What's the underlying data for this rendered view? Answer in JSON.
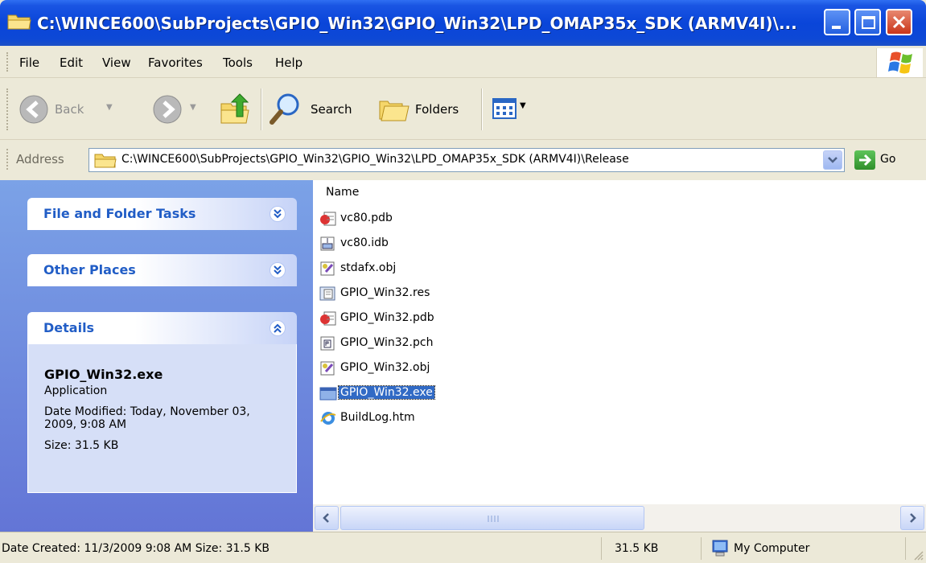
{
  "window": {
    "title": "C:\\WINCE600\\SubProjects\\GPIO_Win32\\GPIO_Win32\\LPD_OMAP35x_SDK (ARMV4I)\\..."
  },
  "menu": {
    "items": [
      "File",
      "Edit",
      "View",
      "Favorites",
      "Tools",
      "Help"
    ]
  },
  "toolbar": {
    "back_label": "Back",
    "search_label": "Search",
    "folders_label": "Folders"
  },
  "address": {
    "label": "Address",
    "value": "C:\\WINCE600\\SubProjects\\GPIO_Win32\\GPIO_Win32\\LPD_OMAP35x_SDK (ARMV4I)\\Release",
    "go_label": "Go"
  },
  "taskpane": {
    "file_folder_tasks": "File and Folder Tasks",
    "other_places": "Other Places",
    "details": {
      "title": "Details",
      "name": "GPIO_Win32.exe",
      "type": "Application",
      "date_modified": "Date Modified: Today, November 03, 2009, 9:08 AM",
      "size": "Size: 31.5 KB"
    }
  },
  "filelist": {
    "column_name": "Name",
    "files": [
      {
        "name": "vc80.pdb",
        "icon": "pdb-icon"
      },
      {
        "name": "vc80.idb",
        "icon": "idb-icon"
      },
      {
        "name": "stdafx.obj",
        "icon": "obj-icon"
      },
      {
        "name": "GPIO_Win32.res",
        "icon": "res-icon"
      },
      {
        "name": "GPIO_Win32.pdb",
        "icon": "pdb-icon"
      },
      {
        "name": "GPIO_Win32.pch",
        "icon": "pch-icon"
      },
      {
        "name": "GPIO_Win32.obj",
        "icon": "obj-icon"
      },
      {
        "name": "GPIO_Win32.exe",
        "icon": "exe-icon",
        "selected": true
      },
      {
        "name": "BuildLog.htm",
        "icon": "ie-icon"
      }
    ]
  },
  "statusbar": {
    "info": "Date Created: 11/3/2009 9:08 AM Size: 31.5 KB",
    "size": "31.5 KB",
    "zone": "My Computer"
  },
  "colors": {
    "titlebar": "#0a45d9",
    "taskpane": "#6e8fe0",
    "selection": "#316ac5"
  }
}
